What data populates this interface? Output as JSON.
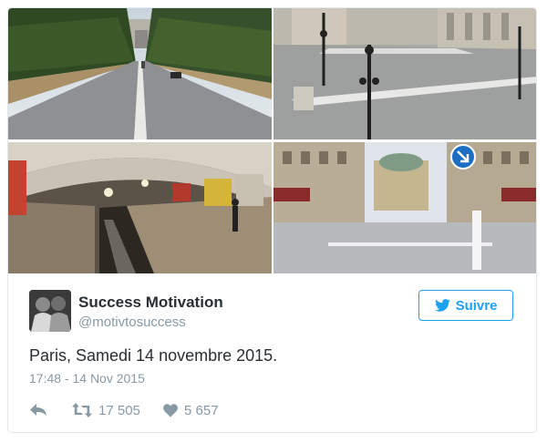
{
  "tweet": {
    "author": {
      "name": "Success Motivation",
      "handle": "@motivtosuccess"
    },
    "follow_label": "Suivre",
    "text": "Paris, Samedi 14 novembre 2015.",
    "timestamp": "17:48 - 14 Nov 2015",
    "stats": {
      "retweets": "17 505",
      "likes": "5 657"
    }
  },
  "photos": [
    {
      "name": "champs-elysees-empty-avenue"
    },
    {
      "name": "empty-square-with-street-lamps"
    },
    {
      "name": "empty-metro-platform"
    },
    {
      "name": "avenue-de-l-opera-empty"
    }
  ],
  "icons": {
    "twitter": "twitter-bird-icon",
    "reply": "reply-icon",
    "retweet": "retweet-icon",
    "like": "heart-icon"
  },
  "colors": {
    "brand_blue": "#1da1f2",
    "secondary_text": "#8899a6",
    "primary_text": "#292f33",
    "border": "#e1e8ed"
  }
}
